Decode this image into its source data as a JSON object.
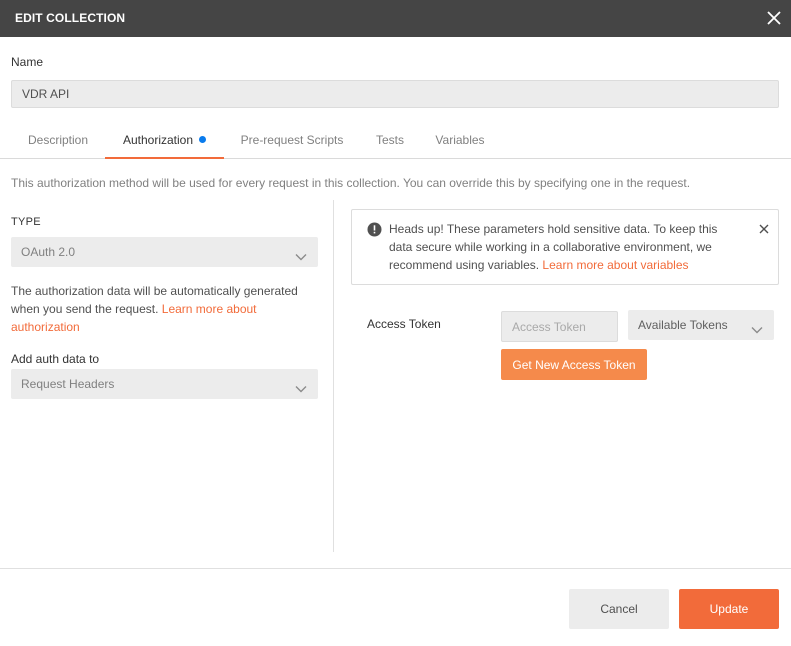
{
  "dialog": {
    "title": "EDIT COLLECTION",
    "close_icon": "close-icon"
  },
  "name": {
    "label": "Name",
    "value": "VDR API"
  },
  "tabs": [
    {
      "label": "Description",
      "active": false
    },
    {
      "label": "Authorization",
      "active": true,
      "has_indicator": true
    },
    {
      "label": "Pre-request Scripts",
      "active": false
    },
    {
      "label": "Tests",
      "active": false
    },
    {
      "label": "Variables",
      "active": false
    }
  ],
  "auth": {
    "info_text": "This authorization method will be used for every request in this collection. You can override this by specifying one in the request.",
    "type_label": "TYPE",
    "type_value": "OAuth 2.0",
    "description_text": "The authorization data will be automatically generated when you send the request.",
    "description_link": "Learn more about authorization",
    "add_auth_label": "Add auth data to",
    "add_auth_value": "Request Headers"
  },
  "alert": {
    "icon": "warning-icon",
    "message": "Heads up! These parameters hold sensitive data. To keep this data secure while working in a collaborative environment, we recommend using variables.",
    "link": "Learn more about variables"
  },
  "token": {
    "label": "Access Token",
    "placeholder": "Access Token",
    "available_label": "Available Tokens",
    "get_new_label": "Get New Access Token"
  },
  "footer": {
    "cancel_label": "Cancel",
    "update_label": "Update"
  },
  "colors": {
    "accent": "#f26b3a",
    "accent_light": "#f58a4b",
    "indicator": "#097bed",
    "titlebar": "#454545"
  }
}
